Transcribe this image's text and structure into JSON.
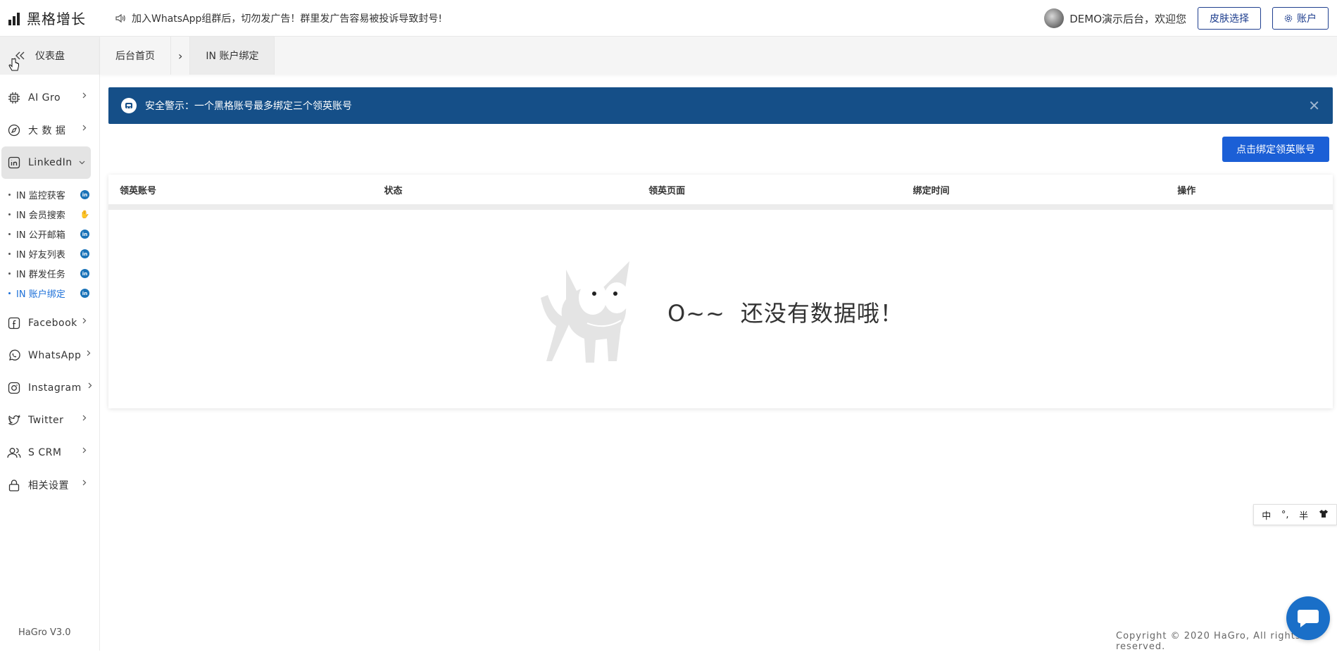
{
  "header": {
    "logo_text": "黑格增长",
    "notice": "加入WhatsApp组群后，切勿发广告！群里发广告容易被投诉导致封号!",
    "welcome": "DEMO演示后台，欢迎您",
    "skin_button": "皮肤选择",
    "account_button": "账户"
  },
  "sidebar": {
    "dashboard_label": "仪表盘",
    "items": [
      {
        "label": "AI Gro",
        "icon": "chip-icon"
      },
      {
        "label": "大 数 据",
        "icon": "compass-icon"
      },
      {
        "label": "LinkedIn",
        "icon": "linkedin-icon"
      },
      {
        "label": "Facebook",
        "icon": "facebook-icon"
      },
      {
        "label": "WhatsApp",
        "icon": "whatsapp-icon"
      },
      {
        "label": "Instagram",
        "icon": "instagram-icon"
      },
      {
        "label": "Twitter",
        "icon": "twitter-icon"
      },
      {
        "label": "S CRM",
        "icon": "users-icon"
      },
      {
        "label": "相关设置",
        "icon": "lock-icon"
      }
    ],
    "linkedin_sub": [
      {
        "label": "IN 监控获客",
        "badge": "in"
      },
      {
        "label": "IN 会员搜索",
        "badge": "hand"
      },
      {
        "label": "IN 公开邮箱",
        "badge": "in"
      },
      {
        "label": "IN 好友列表",
        "badge": "in"
      },
      {
        "label": "IN 群发任务",
        "badge": "in"
      },
      {
        "label": "IN 账户绑定",
        "badge": "in"
      }
    ],
    "version": "HaGro V3.0"
  },
  "tabs": {
    "home": "后台首页",
    "separator": "›",
    "current": "IN 账户绑定"
  },
  "alert": {
    "text": "安全警示：一个黑格账号最多绑定三个领英账号",
    "close": "✕"
  },
  "bind_button": "点击绑定领英账号",
  "table": {
    "columns": [
      "领英账号",
      "状态",
      "领英页面",
      "绑定时间",
      "操作"
    ],
    "rows": [],
    "empty_prefix": "O~~",
    "empty_text": "还没有数据哦！"
  },
  "ime": {
    "lang": "中",
    "punct": "°,",
    "width": "半"
  },
  "footer": {
    "copyright": "Copyright © 2020 HaGro, All rights reserved."
  },
  "colors": {
    "alert_bg": "#154f88",
    "primary": "#1b5fd6",
    "active_link": "#1b6fd8"
  }
}
